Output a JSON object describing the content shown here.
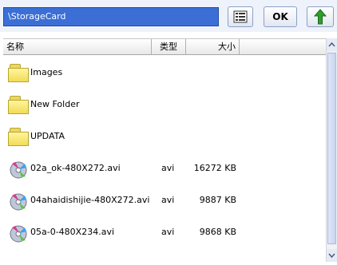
{
  "path": {
    "value": "\\StorageCard"
  },
  "toolbar": {
    "ok_label": "OK"
  },
  "columns": {
    "name": "名称",
    "type": "类型",
    "size": "大小"
  },
  "folders": [
    {
      "name": "Images"
    },
    {
      "name": "New Folder"
    },
    {
      "name": "UPDATA"
    }
  ],
  "files": [
    {
      "name": "02a_ok-480X272.avi",
      "type": "avi",
      "size": "16272 KB"
    },
    {
      "name": "04ahaidishijie-480X272.avi",
      "type": "avi",
      "size": "9887 KB"
    },
    {
      "name": "05a-0-480X234.avi",
      "type": "avi",
      "size": "9868 KB"
    }
  ],
  "colors": {
    "path_bg": "#3b6fd6",
    "folder": "#f2dc55",
    "up_arrow": "#2e9e2e"
  }
}
